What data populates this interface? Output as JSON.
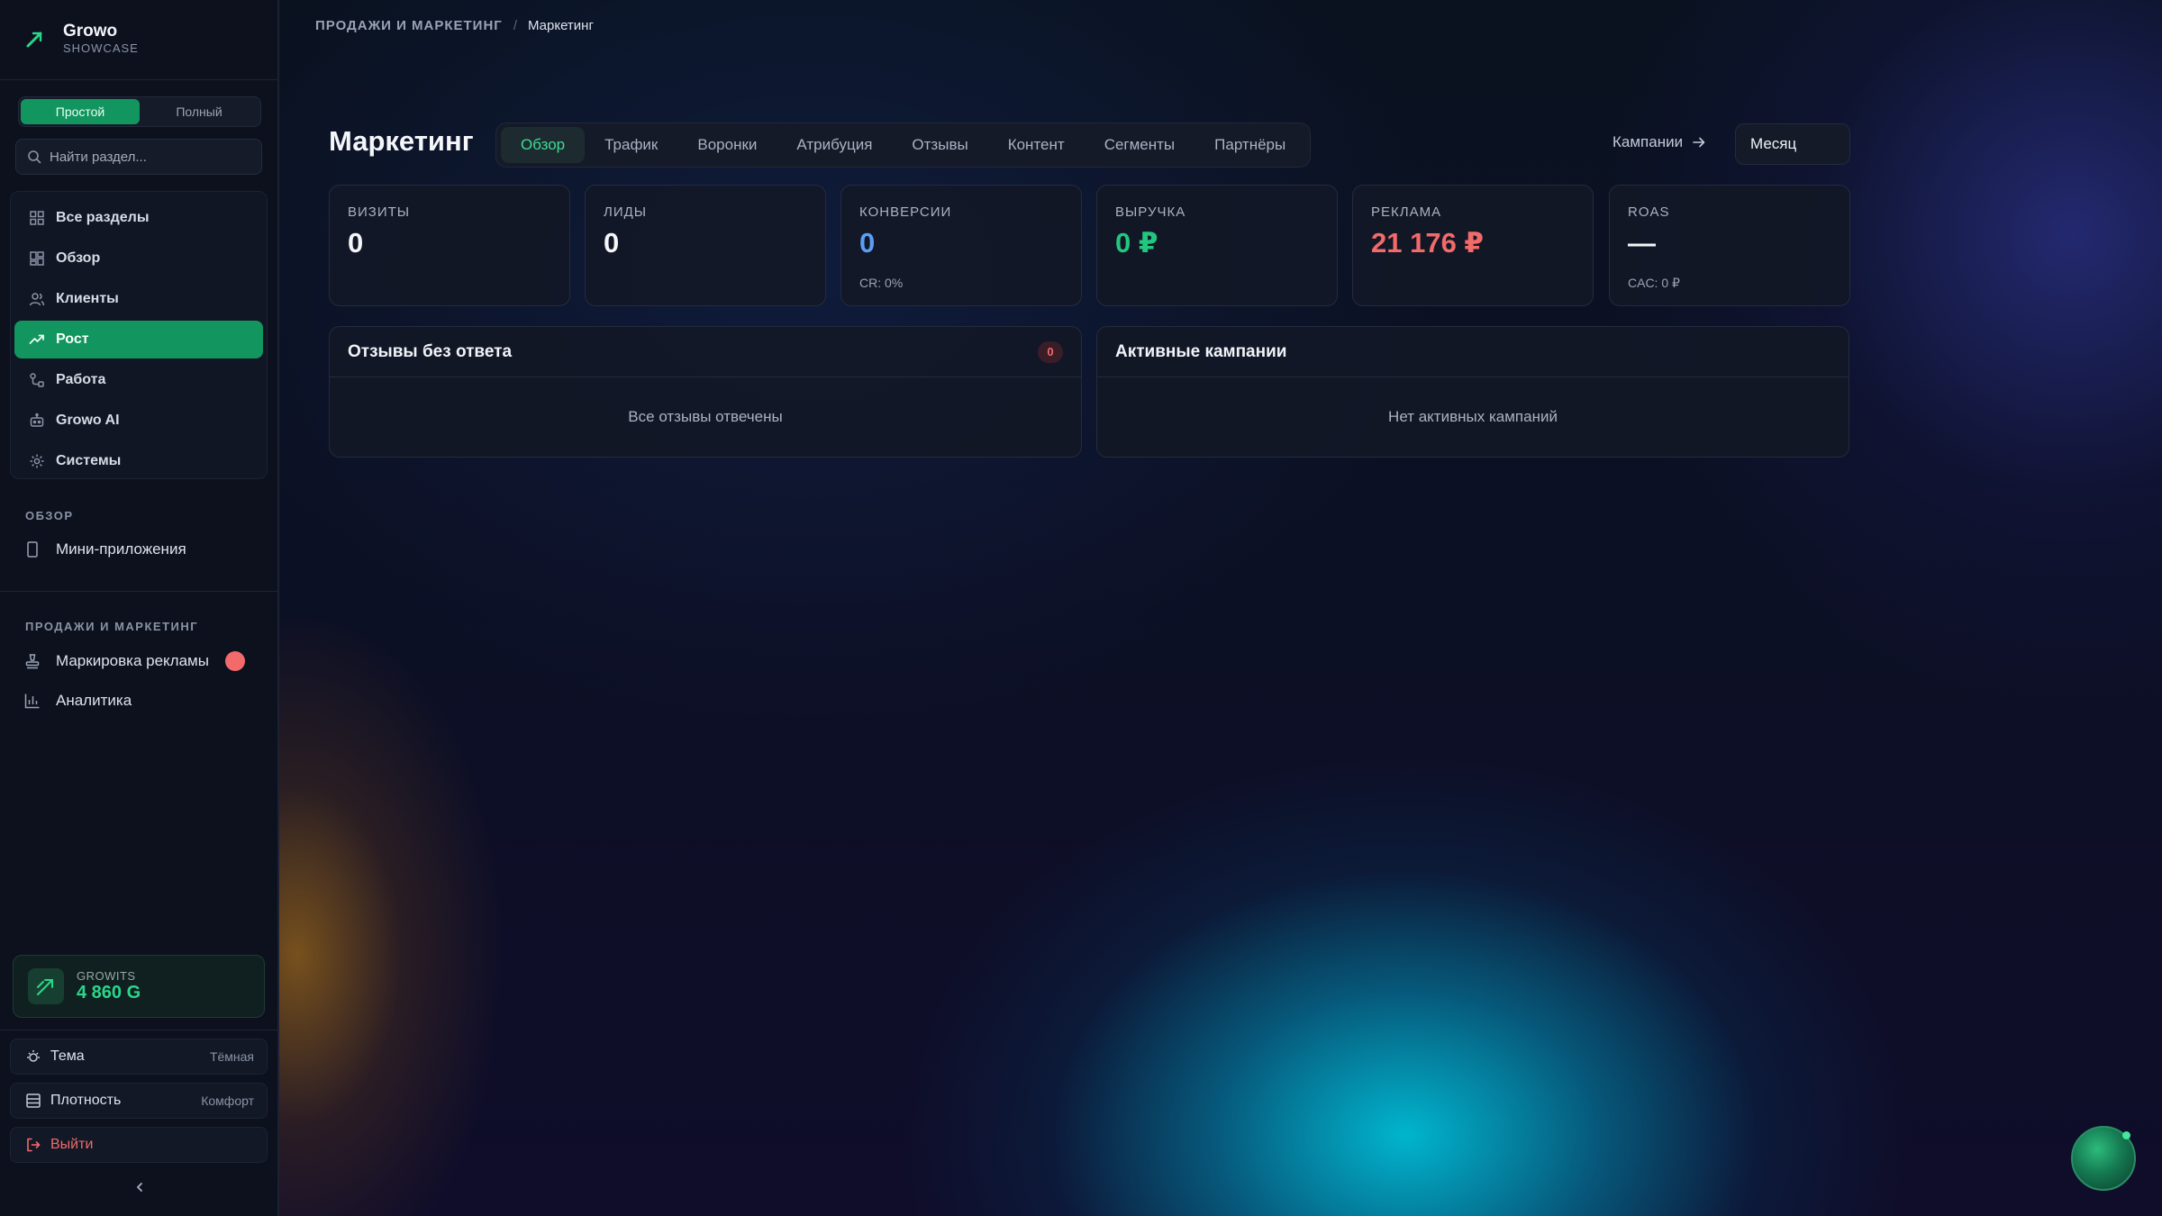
{
  "brand": {
    "name": "Growo",
    "subtitle": "SHOWCASE"
  },
  "mode_toggle": {
    "simple": "Простой",
    "full": "Полный",
    "selected": "Простой"
  },
  "search": {
    "placeholder": "Найти раздел..."
  },
  "nav": [
    {
      "label": "Все разделы",
      "icon": "grid-icon"
    },
    {
      "label": "Обзор",
      "icon": "dashboard-icon"
    },
    {
      "label": "Клиенты",
      "icon": "users-icon"
    },
    {
      "label": "Рост",
      "icon": "trending-up-icon",
      "active": true
    },
    {
      "label": "Работа",
      "icon": "workflow-icon"
    },
    {
      "label": "Growo AI",
      "icon": "bot-icon"
    },
    {
      "label": "Системы",
      "icon": "gear-icon"
    }
  ],
  "sections": {
    "overview": {
      "title": "ОБЗОР",
      "items": [
        {
          "label": "Мини-приложения",
          "icon": "smartphone-icon"
        }
      ]
    },
    "sales": {
      "title": "ПРОДАЖИ И МАРКЕТИНГ",
      "items": [
        {
          "label": "Маркировка рекламы",
          "icon": "stamp-icon"
        },
        {
          "label": "Аналитика",
          "icon": "bar-chart-icon"
        }
      ]
    }
  },
  "growits": {
    "label": "GROWITS",
    "value": "4 860 G"
  },
  "settings": {
    "theme": {
      "label": "Тема",
      "value": "Тёмная"
    },
    "density": {
      "label": "Плотность",
      "value": "Комфорт"
    },
    "logout": {
      "label": "Выйти"
    }
  },
  "breadcrumb": {
    "parent": "ПРОДАЖИ И МАРКЕТИНГ",
    "separator": "/",
    "current": "Маркетинг"
  },
  "page": {
    "title": "Маркетинг"
  },
  "tabs": [
    "Обзор",
    "Трафик",
    "Воронки",
    "Атрибуция",
    "Отзывы",
    "Контент",
    "Сегменты",
    "Партнёры"
  ],
  "active_tab": "Обзор",
  "campaigns_link": "Кампании",
  "period": "Месяц",
  "kpis": [
    {
      "label": "ВИЗИТЫ",
      "value": "0",
      "sub": "",
      "color": "#f4f6fa"
    },
    {
      "label": "ЛИДЫ",
      "value": "0",
      "sub": "",
      "color": "#f4f6fa"
    },
    {
      "label": "КОНВЕРСИИ",
      "value": "0",
      "sub": "CR: 0%",
      "color": "#5b9ef5"
    },
    {
      "label": "ВЫРУЧКА",
      "value": "0 ₽",
      "sub": "",
      "color": "#22c67f"
    },
    {
      "label": "РЕКЛАМА",
      "value": "21 176 ₽",
      "sub": "",
      "color": "#f26a6a"
    },
    {
      "label": "ROAS",
      "value": "—",
      "sub": "CAC: 0 ₽",
      "color": "#f4f6fa"
    }
  ],
  "panels": {
    "reviews": {
      "title": "Отзывы без ответа",
      "badge": "0",
      "empty": "Все отзывы отвечены"
    },
    "campaigns": {
      "title": "Активные кампании",
      "empty": "Нет активных кампаний"
    }
  },
  "colors": {
    "accent": "#13955f",
    "accent_text": "#3fdc95",
    "danger": "#f26a6a",
    "info": "#5b9ef5"
  }
}
